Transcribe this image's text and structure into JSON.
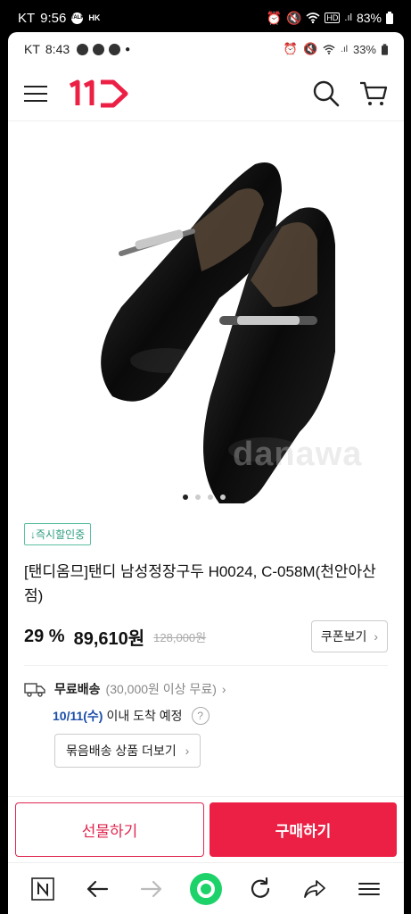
{
  "outer_status": {
    "carrier": "KT",
    "time": "9:56",
    "region": "HK",
    "battery": "83%"
  },
  "inner_status": {
    "carrier": "KT",
    "time": "8:43",
    "battery": "33%"
  },
  "header": {
    "logo": "11"
  },
  "product": {
    "watermark": "danawa",
    "pager_count": 4,
    "badge": "↓즉시할인중",
    "title": "[탠디옴므]탠디 남성정장구두 H0024, C-058M(천안아산점)",
    "discount": "29 %",
    "price": "89,610원",
    "original_price": "128,000원",
    "coupon_label": "쿠폰보기",
    "shipping_label": "무료배송",
    "shipping_condition": "(30,000원 이상 무료)",
    "eta_date": "10/11(수)",
    "eta_text": "이내 도착 예정",
    "bundle_label": "묶음배송 상품 더보기"
  },
  "bottom": {
    "gift": "선물하기",
    "buy": "구매하기"
  },
  "colors": {
    "brand": "#ec1f45",
    "accent_green": "#2f9e80",
    "eta_blue": "#1c4ea8"
  }
}
